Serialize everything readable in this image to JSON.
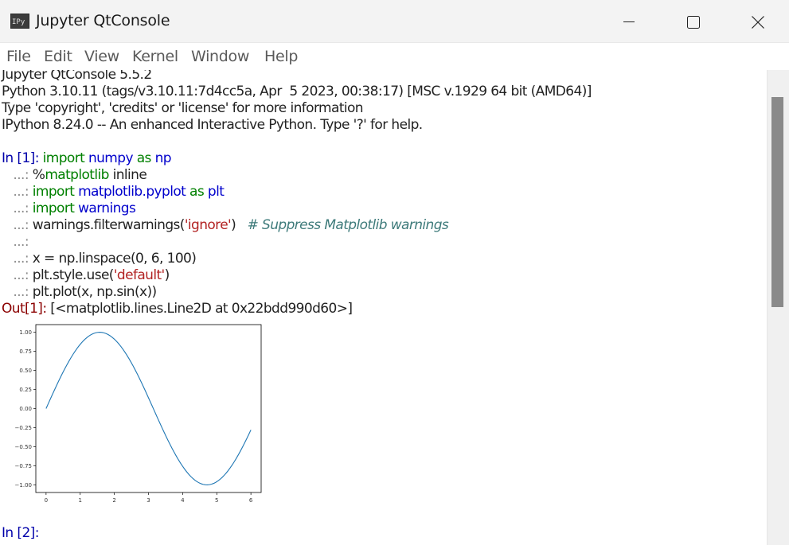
{
  "window": {
    "title": "Jupyter QtConsole",
    "icon_text": "IPy",
    "icons": {
      "app": "ipython-app-icon",
      "minimize": "minimize-icon",
      "maximize": "maximize-icon",
      "close": "close-icon"
    }
  },
  "menu": [
    "File",
    "Edit",
    "View",
    "Kernel",
    "Window",
    "Help"
  ],
  "banner": [
    "Jupyter QtConsole 5.5.2",
    "Python 3.10.11 (tags/v3.10.11:7d4cc5a, Apr  5 2023, 00:38:17) [MSC v.1929 64 bit (AMD64)]",
    "Type 'copyright', 'credits' or 'license' for more information",
    "IPython 8.24.0 -- An enhanced Interactive Python. Type '?' for help."
  ],
  "cell1": {
    "prompt_in_prefix": "In [",
    "prompt_number": "1",
    "prompt_in_suffix": "]: ",
    "continuation": "   ...: ",
    "line1": {
      "kw1": "import",
      "mod": " numpy",
      "kw2": " as",
      "alias": " np"
    },
    "line2": {
      "magic_pct": "%",
      "magic_name": "matplotlib",
      "rest": " inline"
    },
    "line3": {
      "kw1": "import",
      "mod": " matplotlib.pyplot",
      "kw2": " as",
      "alias": " plt"
    },
    "line4": {
      "kw1": "import",
      "mod": " warnings"
    },
    "line5": {
      "pre": "warnings.filterwarnings(",
      "str": "'ignore'",
      "post": ")   ",
      "comment": "# Suppress Matplotlib warnings"
    },
    "line7": "x = np.linspace(0, 6, 100)",
    "line8": {
      "pre": "plt.style.use(",
      "str": "'default'",
      "post": ")"
    },
    "line9": "plt.plot(x, np.sin(x))",
    "out_prefix": "Out[",
    "out_number": "1",
    "out_suffix": "]: ",
    "out_text": "[<matplotlib.lines.Line2D at 0x22bdd990d60>]"
  },
  "cell2": {
    "prompt_in_prefix": "In [",
    "prompt_number": "2",
    "prompt_in_suffix": "]: "
  },
  "chart_data": {
    "type": "line",
    "series": [
      {
        "function": "sin(x)",
        "x_start": 0,
        "x_end": 6,
        "num_points": 100,
        "color": "#1f77b4"
      }
    ],
    "xlim": [
      -0.3,
      6.3
    ],
    "ylim": [
      -1.1,
      1.1
    ],
    "xticks": [
      "0",
      "1",
      "2",
      "3",
      "4",
      "5",
      "6"
    ],
    "yticks": [
      "1.00",
      "0.75",
      "0.50",
      "0.25",
      "0.00",
      "−0.25",
      "−0.50",
      "−0.75",
      "−1.00"
    ],
    "ytick_values": [
      1,
      0.75,
      0.5,
      0.25,
      0,
      -0.25,
      -0.5,
      -0.75,
      -1
    ],
    "grid": false
  },
  "colors": {
    "keyword": "#008000",
    "module": "#0000cc",
    "string": "#b22222",
    "comment": "#3d7a7a",
    "prompt_in": "#0000aa",
    "prompt_out": "#8b0000"
  }
}
